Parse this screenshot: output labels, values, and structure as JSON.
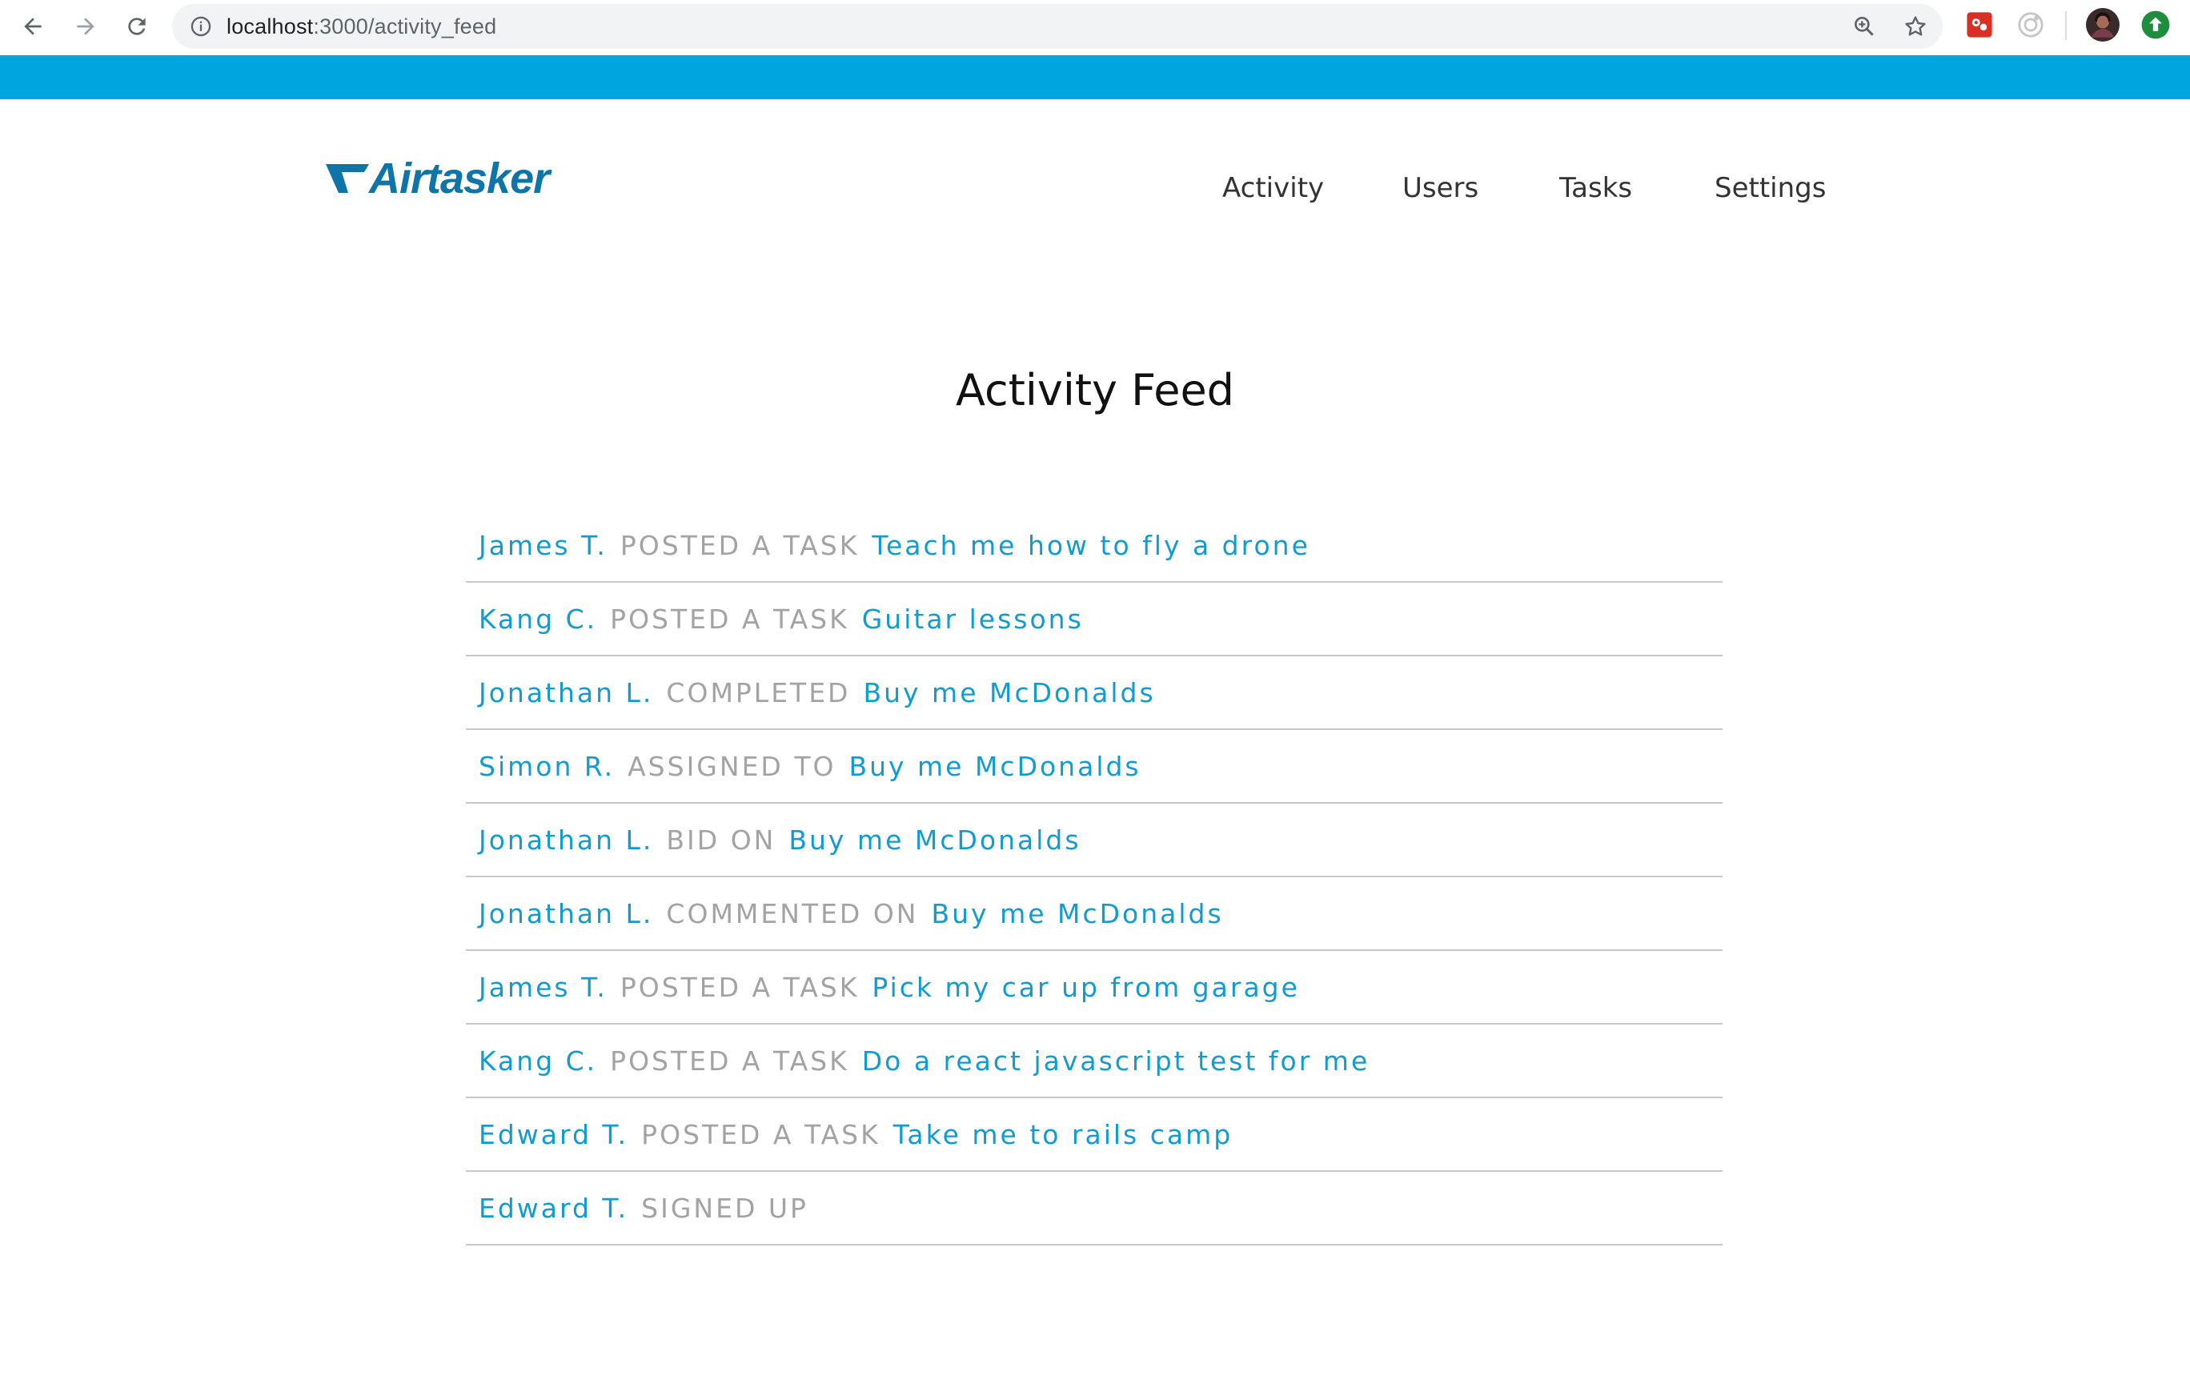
{
  "browser": {
    "url_host": "localhost",
    "url_path": ":3000/activity_feed"
  },
  "site": {
    "logo_text": "Airtasker",
    "nav": [
      {
        "label": "Activity"
      },
      {
        "label": "Users"
      },
      {
        "label": "Tasks"
      },
      {
        "label": "Settings"
      }
    ]
  },
  "main": {
    "title": "Activity Feed",
    "feed": [
      {
        "user": "James T.",
        "action": "POSTED A TASK",
        "task": "Teach me how to fly a drone"
      },
      {
        "user": "Kang C.",
        "action": "POSTED A TASK",
        "task": "Guitar lessons"
      },
      {
        "user": "Jonathan L.",
        "action": "COMPLETED",
        "task": "Buy me McDonalds"
      },
      {
        "user": "Simon R.",
        "action": "ASSIGNED TO",
        "task": "Buy me McDonalds"
      },
      {
        "user": "Jonathan L.",
        "action": "BID ON",
        "task": "Buy me McDonalds"
      },
      {
        "user": "Jonathan L.",
        "action": "COMMENTED ON",
        "task": "Buy me McDonalds"
      },
      {
        "user": "James T.",
        "action": "POSTED A TASK",
        "task": "Pick my car up from garage"
      },
      {
        "user": "Kang C.",
        "action": "POSTED A TASK",
        "task": "Do a react javascript test for me"
      },
      {
        "user": "Edward T.",
        "action": "POSTED A TASK",
        "task": "Take me to rails camp"
      },
      {
        "user": "Edward T.",
        "action": "SIGNED UP",
        "task": ""
      }
    ]
  },
  "colors": {
    "accent_bar": "#00a5df",
    "link": "#119bd2",
    "action_text": "#a3a3a3",
    "logo": "#0f74a8"
  },
  "icons": {
    "back": "back-arrow-icon",
    "forward": "forward-arrow-icon",
    "reload": "reload-icon",
    "info": "info-icon",
    "zoom": "zoom-icon",
    "bookmark": "star-icon"
  }
}
